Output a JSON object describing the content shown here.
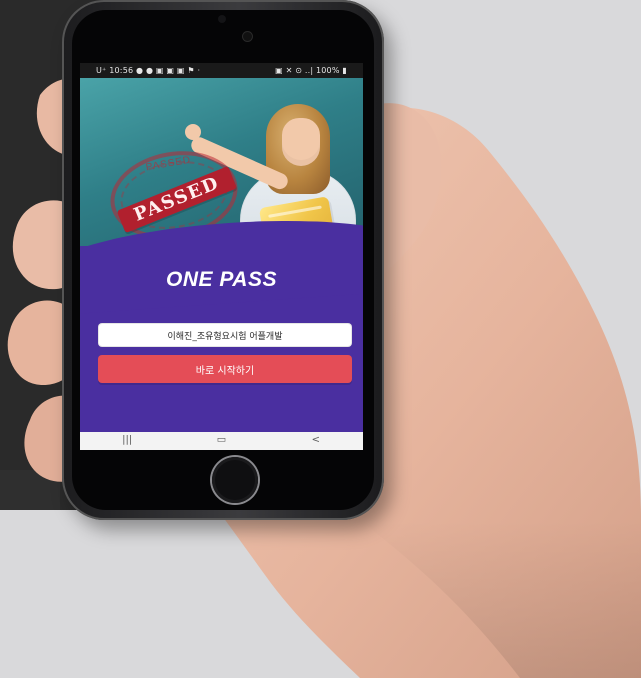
{
  "status_bar": {
    "left_text": "U⁺ 10:56 ● ● ▣ ▣ ▣ ⚑ ·",
    "right_text": "▣ ✕ ⊙ ..| 100% ▮"
  },
  "hero": {
    "stamp_top": "PASSED",
    "stamp_banner": "PASSED"
  },
  "app": {
    "title": "ONE PASS",
    "input_value": "이해진_조유형요시험 어플개발",
    "start_button": "바로 시작하기"
  },
  "nav": {
    "recent_icon": "|||",
    "home_icon": "▭",
    "back_icon": "<"
  },
  "colors": {
    "screen_purple": "#4a2fa0",
    "start_red": "#e44d57",
    "background_gray": "#d9d9db",
    "background_dark": "#2a2a2a"
  }
}
